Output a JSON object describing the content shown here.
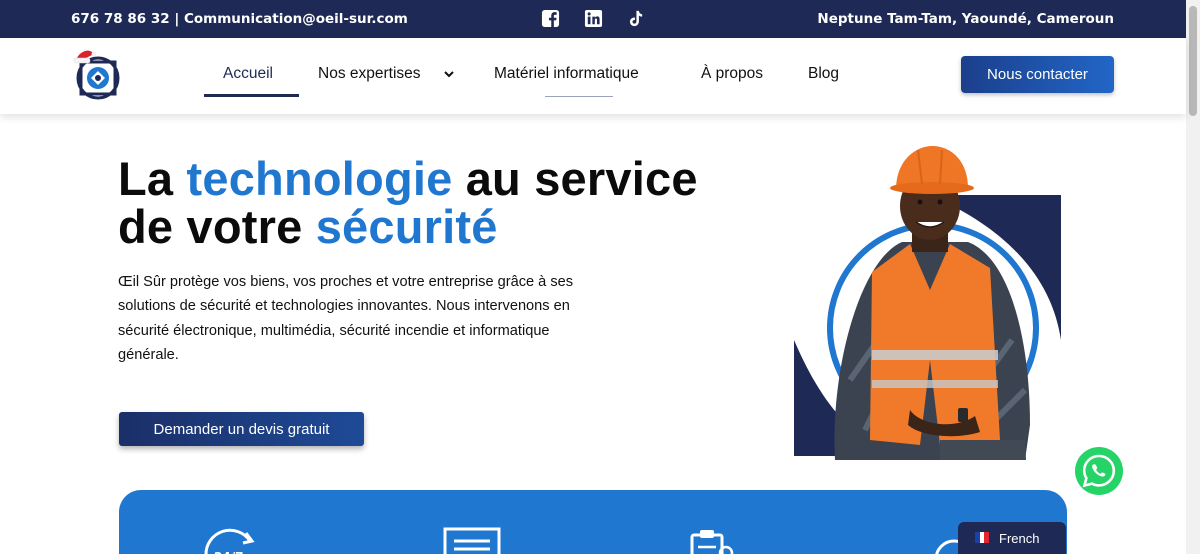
{
  "topbar": {
    "contact": "676 78 86 32 | Communication@oeil-sur.com",
    "address": "Neptune Tam-Tam, Yaoundé, Cameroun",
    "social_icons": [
      "facebook-icon",
      "linkedin-icon",
      "tiktok-icon"
    ]
  },
  "nav": {
    "items": [
      {
        "label": "Accueil",
        "active": true
      },
      {
        "label": "Nos expertises",
        "has_dropdown": true
      },
      {
        "label": "Matériel informatique"
      },
      {
        "label": "À propos"
      },
      {
        "label": "Blog"
      }
    ],
    "cta": "Nous contacter"
  },
  "hero": {
    "title_part1": "La ",
    "title_accent1": "technologie",
    "title_part2": " au service",
    "title_part3": "de votre ",
    "title_accent2": "sécurité",
    "description": "Œil Sûr protège vos biens, vos proches et votre entreprise grâce à ses solutions de sécurité et technologies innovantes. Nous intervenons en sécurité électronique, multimédia, sécurité incendie et informatique générale.",
    "cta": "Demander un devis gratuit"
  },
  "language": {
    "label": "French"
  },
  "colors": {
    "navy": "#1e2a55",
    "accent_blue": "#1f77d0",
    "button_blue": "#1b3f8c"
  }
}
